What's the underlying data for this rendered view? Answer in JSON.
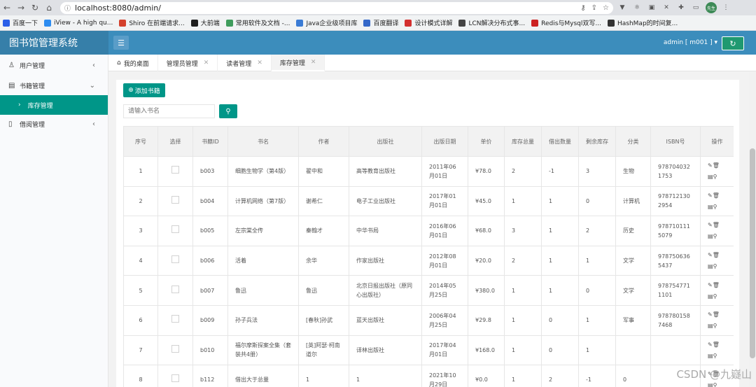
{
  "browser": {
    "url": "localhost:8080/admin/",
    "bookmarks": [
      "百度一下",
      "iView - A high qu...",
      "Shiro 在前端请求...",
      "大前端",
      "常用软件及文档 -...",
      "Java企业级项目库",
      "百度翻译",
      "设计模式详解",
      "LCN解决分布式事...",
      "Redis与Mysql双写...",
      "HashMap的时间复..."
    ],
    "bookmark_colors": [
      "#2a5ee8",
      "#2d8cf0",
      "#d4412d",
      "#1e1e1e",
      "#3f9c5c",
      "#3a7bd5",
      "#3468c9",
      "#d3302f",
      "#444444",
      "#cc2222",
      "#333333"
    ],
    "avatar_label": "先生"
  },
  "header": {
    "app_title": "图书馆管理系统",
    "user": "admin [ m001 ]"
  },
  "sidebar": {
    "items": [
      {
        "label": "用户管理"
      },
      {
        "label": "书籍管理"
      },
      {
        "label": "库存管理"
      },
      {
        "label": "借阅管理"
      }
    ]
  },
  "tabs": [
    {
      "label": "我的桌面"
    },
    {
      "label": "管理员管理"
    },
    {
      "label": "读者管理"
    },
    {
      "label": "库存管理"
    }
  ],
  "toolbar": {
    "add_label": "添加书籍",
    "search_placeholder": "请输入书名"
  },
  "table": {
    "headers": [
      "序号",
      "选择",
      "书籍ID",
      "书名",
      "作者",
      "出版社",
      "出版日期",
      "单价",
      "库存总量",
      "借出数量",
      "剩余库存",
      "分类",
      "ISBN号",
      "操作"
    ],
    "rows": [
      [
        "1",
        "",
        "b003",
        "细胞生物学（第4版）",
        "翟中和",
        "高等教育出版社",
        "2011年06月01日",
        "¥78.0",
        "2",
        "-1",
        "3",
        "生物",
        "9787040321753"
      ],
      [
        "2",
        "",
        "b004",
        "计算机网络（第7版）",
        "谢希仁",
        "电子工业出版社",
        "2017年01月01日",
        "¥45.0",
        "1",
        "1",
        "0",
        "计算机",
        "9787121302954"
      ],
      [
        "3",
        "",
        "b005",
        "左宗棠全传",
        "秦翰才",
        "中华书局",
        "2016年06月01日",
        "¥68.0",
        "3",
        "1",
        "2",
        "历史",
        "9787101115079"
      ],
      [
        "4",
        "",
        "b006",
        "活着",
        "余华",
        "作家出版社",
        "2012年08月01日",
        "¥20.0",
        "2",
        "1",
        "1",
        "文学",
        "9787506365437"
      ],
      [
        "5",
        "",
        "b007",
        "鲁迅",
        "鲁迅",
        "北京日报出版社（原同心出版社）",
        "2014年05月25日",
        "¥380.0",
        "1",
        "1",
        "0",
        "文学",
        "9787547711101"
      ],
      [
        "6",
        "",
        "b009",
        "孙子兵法",
        "[春秋]孙武",
        "蓝天出版社",
        "2006年04月25日",
        "¥29.8",
        "1",
        "0",
        "1",
        "军事",
        "9787801587468"
      ],
      [
        "7",
        "",
        "b010",
        "福尔摩斯探案全集（套装共4册）",
        "[英]阿瑟·柯南道尔",
        "译林出版社",
        "2017年04月01日",
        "¥168.0",
        "1",
        "0",
        "1",
        "",
        ""
      ],
      [
        "8",
        "",
        "b112",
        "借出大于总量",
        "1",
        "1",
        "2021年10月29日",
        "¥0.0",
        "1",
        "2",
        "-1",
        "0",
        ""
      ]
    ]
  },
  "watermark": "CSDN @九嶷山"
}
